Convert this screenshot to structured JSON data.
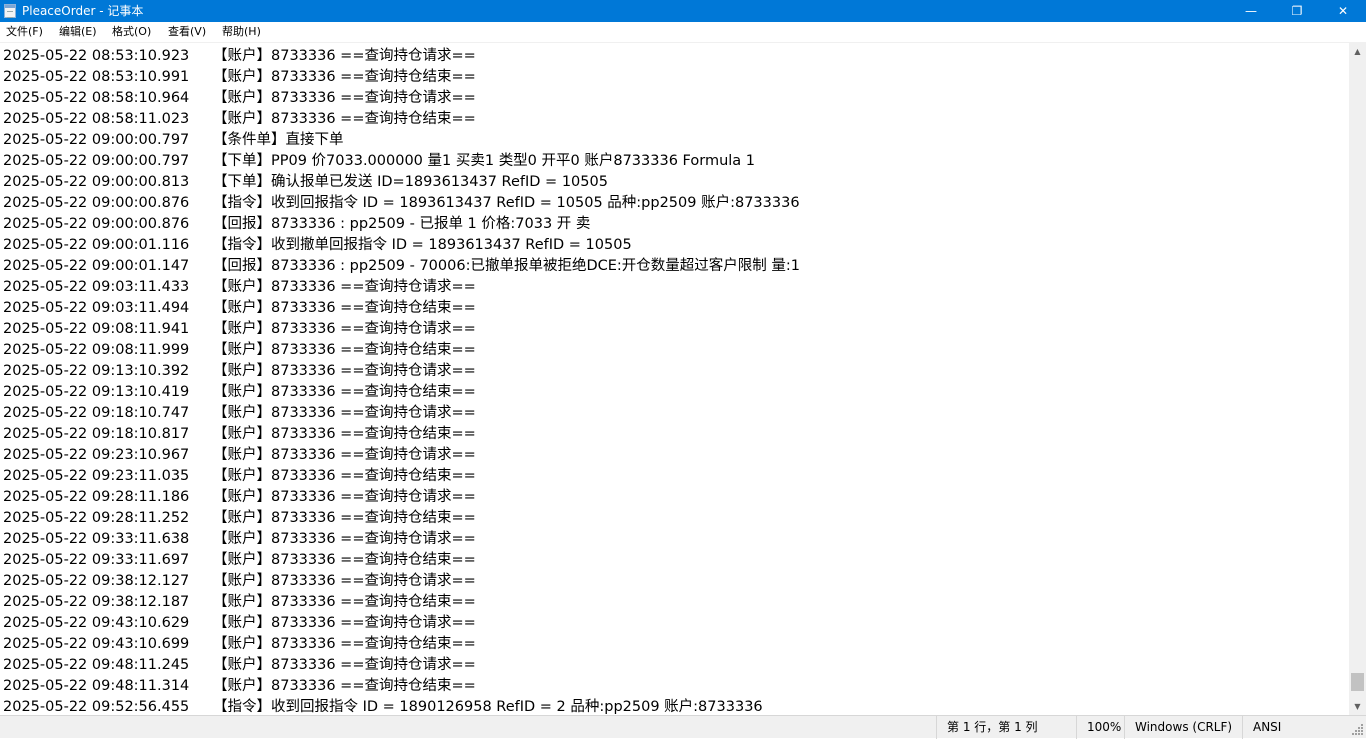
{
  "window": {
    "title": "PleaceOrder - 记事本",
    "minimize_glyph": "—",
    "maximize_glyph": "❐",
    "close_glyph": "✕"
  },
  "menu": {
    "file": "文件(F)",
    "edit": "编辑(E)",
    "format": "格式(O)",
    "view": "查看(V)",
    "help": "帮助(H)"
  },
  "lines": [
    {
      "ts": "2025-05-22 08:53:10.923",
      "msg": "【账户】8733336 ==查询持仓请求=="
    },
    {
      "ts": "2025-05-22 08:53:10.991",
      "msg": "【账户】8733336 ==查询持仓结束=="
    },
    {
      "ts": "2025-05-22 08:58:10.964",
      "msg": "【账户】8733336 ==查询持仓请求=="
    },
    {
      "ts": "2025-05-22 08:58:11.023",
      "msg": "【账户】8733336 ==查询持仓结束=="
    },
    {
      "ts": "2025-05-22 09:00:00.797",
      "msg": "【条件单】直接下单"
    },
    {
      "ts": "2025-05-22 09:00:00.797",
      "msg": "【下单】PP09 价7033.000000 量1 买卖1 类型0 开平0 账户8733336 Formula 1"
    },
    {
      "ts": "2025-05-22 09:00:00.813",
      "msg": "【下单】确认报单已发送 ID=1893613437 RefID = 10505"
    },
    {
      "ts": "2025-05-22 09:00:00.876",
      "msg": "【指令】收到回报指令 ID = 1893613437 RefID = 10505 品种:pp2509 账户:8733336"
    },
    {
      "ts": "2025-05-22 09:00:00.876",
      "msg": "【回报】8733336 : pp2509 - 已报单 1 价格:7033 开 卖"
    },
    {
      "ts": "2025-05-22 09:00:01.116",
      "msg": "【指令】收到撤单回报指令 ID = 1893613437 RefID = 10505"
    },
    {
      "ts": "2025-05-22 09:00:01.147",
      "msg": "【回报】8733336 : pp2509 - 70006:已撤单报单被拒绝DCE:开仓数量超过客户限制 量:1"
    },
    {
      "ts": "2025-05-22 09:03:11.433",
      "msg": "【账户】8733336 ==查询持仓请求=="
    },
    {
      "ts": "2025-05-22 09:03:11.494",
      "msg": "【账户】8733336 ==查询持仓结束=="
    },
    {
      "ts": "2025-05-22 09:08:11.941",
      "msg": "【账户】8733336 ==查询持仓请求=="
    },
    {
      "ts": "2025-05-22 09:08:11.999",
      "msg": "【账户】8733336 ==查询持仓结束=="
    },
    {
      "ts": "2025-05-22 09:13:10.392",
      "msg": "【账户】8733336 ==查询持仓请求=="
    },
    {
      "ts": "2025-05-22 09:13:10.419",
      "msg": "【账户】8733336 ==查询持仓结束=="
    },
    {
      "ts": "2025-05-22 09:18:10.747",
      "msg": "【账户】8733336 ==查询持仓请求=="
    },
    {
      "ts": "2025-05-22 09:18:10.817",
      "msg": "【账户】8733336 ==查询持仓结束=="
    },
    {
      "ts": "2025-05-22 09:23:10.967",
      "msg": "【账户】8733336 ==查询持仓请求=="
    },
    {
      "ts": "2025-05-22 09:23:11.035",
      "msg": "【账户】8733336 ==查询持仓结束=="
    },
    {
      "ts": "2025-05-22 09:28:11.186",
      "msg": "【账户】8733336 ==查询持仓请求=="
    },
    {
      "ts": "2025-05-22 09:28:11.252",
      "msg": "【账户】8733336 ==查询持仓结束=="
    },
    {
      "ts": "2025-05-22 09:33:11.638",
      "msg": "【账户】8733336 ==查询持仓请求=="
    },
    {
      "ts": "2025-05-22 09:33:11.697",
      "msg": "【账户】8733336 ==查询持仓结束=="
    },
    {
      "ts": "2025-05-22 09:38:12.127",
      "msg": "【账户】8733336 ==查询持仓请求=="
    },
    {
      "ts": "2025-05-22 09:38:12.187",
      "msg": "【账户】8733336 ==查询持仓结束=="
    },
    {
      "ts": "2025-05-22 09:43:10.629",
      "msg": "【账户】8733336 ==查询持仓请求=="
    },
    {
      "ts": "2025-05-22 09:43:10.699",
      "msg": "【账户】8733336 ==查询持仓结束=="
    },
    {
      "ts": "2025-05-22 09:48:11.245",
      "msg": "【账户】8733336 ==查询持仓请求=="
    },
    {
      "ts": "2025-05-22 09:48:11.314",
      "msg": "【账户】8733336 ==查询持仓结束=="
    },
    {
      "ts": "2025-05-22 09:52:56.455",
      "msg": "【指令】收到回报指令 ID = 1890126958 RefID = 2 品种:pp2509 账户:8733336"
    }
  ],
  "scrollbar": {
    "up_icon": "scroll-up-arrow",
    "down_icon": "scroll-down-arrow",
    "up_glyph": "▲",
    "down_glyph": "▼"
  },
  "status": {
    "position": "第 1 行，第 1 列",
    "zoom": "100%",
    "line_ending": "Windows (CRLF)",
    "encoding": "ANSI"
  },
  "colors": {
    "titlebar": "#0078d7",
    "statusbar": "#f0f0f0"
  }
}
